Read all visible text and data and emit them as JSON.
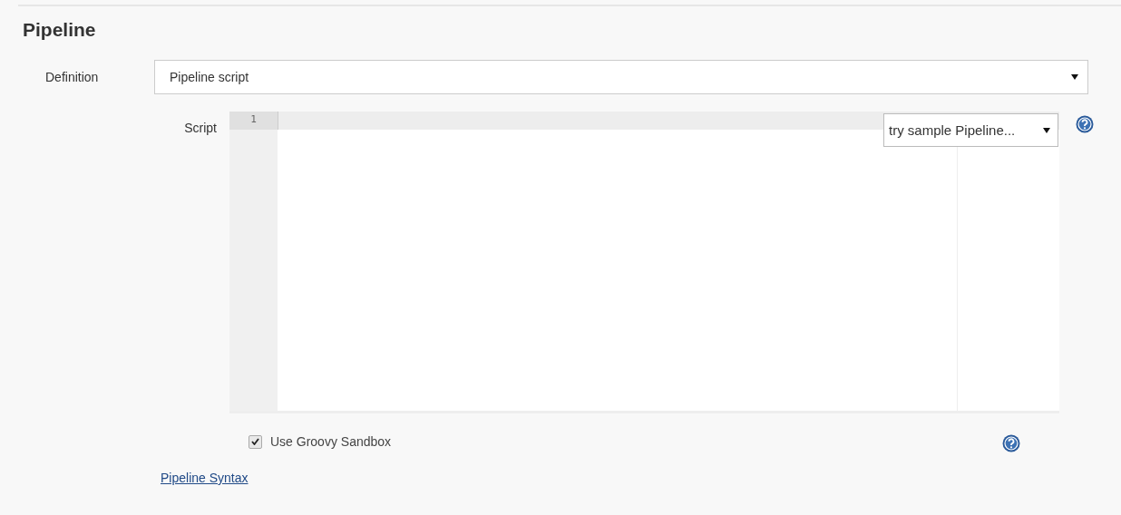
{
  "section": {
    "title": "Pipeline"
  },
  "definition": {
    "label": "Definition",
    "value": "Pipeline script"
  },
  "script": {
    "label": "Script",
    "line_numbers": [
      "1"
    ],
    "sample_select": "try sample Pipeline..."
  },
  "sandbox": {
    "label": "Use Groovy Sandbox",
    "checked": true
  },
  "syntax_link": "Pipeline Syntax"
}
